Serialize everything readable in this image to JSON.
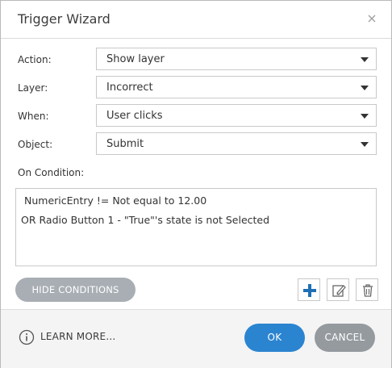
{
  "dialog": {
    "title": "Trigger Wizard",
    "close_icon": "close-icon"
  },
  "fields": {
    "action": {
      "label": "Action:",
      "value": "Show layer"
    },
    "layer": {
      "label": "Layer:",
      "value": "Incorrect"
    },
    "when": {
      "label": "When:",
      "value": "User clicks"
    },
    "object": {
      "label": "Object:",
      "value": "Submit"
    }
  },
  "conditions": {
    "label": "On Condition:",
    "lines": [
      "NumericEntry != Not equal to 12.00",
      "OR Radio Button 1 - \"True\"'s state is not Selected"
    ]
  },
  "toolbar": {
    "hide_conditions_label": "HIDE CONDITIONS",
    "add_icon": "plus-icon",
    "edit_icon": "edit-icon",
    "delete_icon": "trash-icon"
  },
  "footer": {
    "learn_more_label": "LEARN MORE...",
    "ok_label": "OK",
    "cancel_label": "CANCEL"
  },
  "colors": {
    "ok_button": "#2b84d0",
    "cancel_button": "#959a9f",
    "hide_conditions_button": "#a8aeb4",
    "add_icon": "#1f6fb5"
  }
}
